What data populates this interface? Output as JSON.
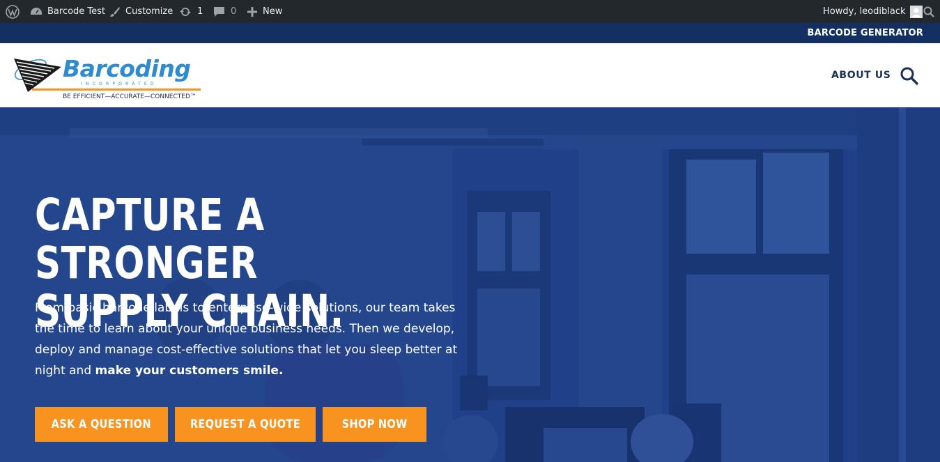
{
  "adminbar": {
    "site_name": "Barcode Test",
    "customize": "Customize",
    "updates_count": "1",
    "comments_count": "0",
    "new_label": "New",
    "greeting": "Howdy, leodiblack"
  },
  "topstrip": {
    "link": "BARCODE GENERATOR"
  },
  "header": {
    "logo": {
      "wordmark": "Barcoding",
      "incorporated": "INCORPORATED",
      "tagline": "BE EFFICIENT—ACCURATE—CONNECTED™"
    },
    "nav": {
      "about": "ABOUT US"
    }
  },
  "hero": {
    "title_line1": "CAPTURE A STRONGER",
    "title_line2": "SUPPLY CHAIN.",
    "body_text": "From basic barcode labels to enterprise-wide solutions, our team takes the time to learn about your unique business needs. Then we develop, deploy and manage cost-effective solutions that let you sleep better at night and ",
    "body_bold": "make your customers smile.",
    "buttons": {
      "ask": "ASK A QUESTION",
      "quote": "REQUEST A QUOTE",
      "shop": "SHOP NOW"
    }
  },
  "colors": {
    "adminbar": "#23282d",
    "strip": "#142f62",
    "accent_orange": "#f7931e",
    "logo_blue": "#2f8bd0",
    "hero_overlay": "#1e3f86"
  }
}
